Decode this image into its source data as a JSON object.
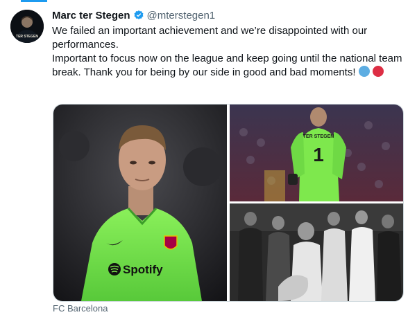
{
  "tweet": {
    "display_name": "Marc ter Stegen",
    "handle": "@mterstegen1",
    "text_line_1": "We failed an important achievement and we’re disappointed with our performances.",
    "text_line_2": "Important to focus now on the league and keep going until the national team break. Thank you for being by our side in good and bad moments!",
    "avatar_shirt_text": "TER STEGEN",
    "verified": true
  },
  "media": {
    "photo1_sponsor": "Spotify",
    "photo2_shirt_text": "TER STEGEN",
    "source": "FC Barcelona"
  },
  "colors": {
    "accent": "#1d9bf0",
    "emoji_blue": "#5dade2",
    "emoji_red": "#dd2e44",
    "jersey": "#7ee84d"
  },
  "icons": [
    "verified-badge-icon",
    "blue-circle-emoji-icon",
    "red-circle-emoji-icon"
  ]
}
